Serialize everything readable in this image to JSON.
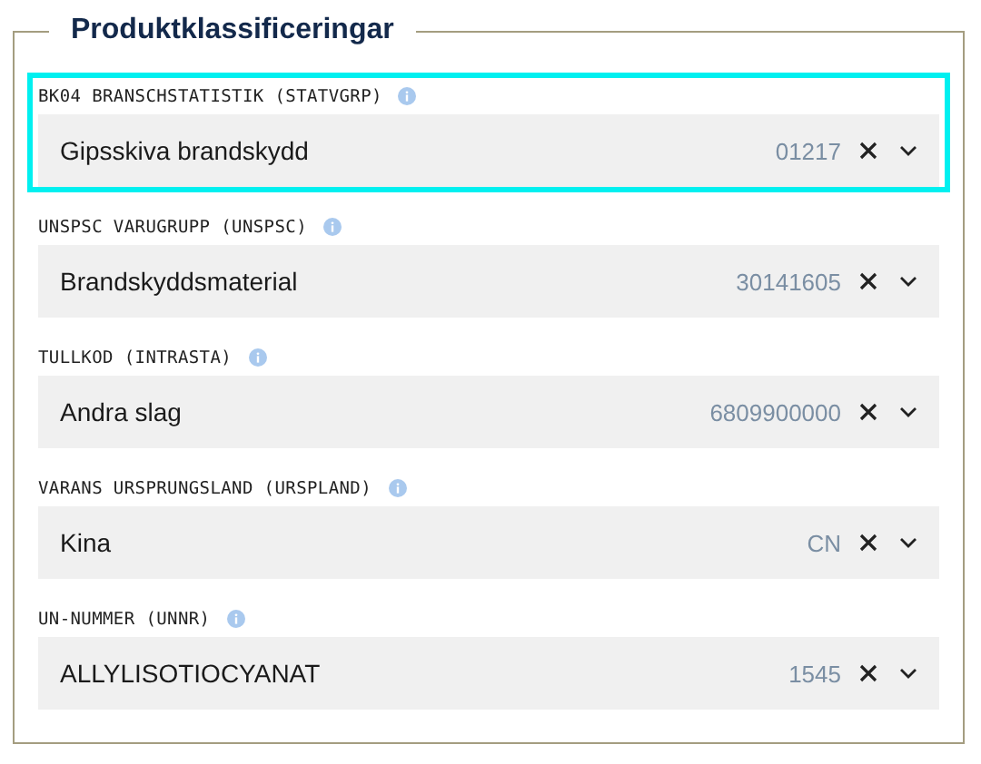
{
  "section": {
    "title": "Produktklassificeringar"
  },
  "fields": [
    {
      "label": "BK04 BRANSCHSTATISTIK (STATVGRP)",
      "value": "Gipsskiva brandskydd",
      "code": "01217",
      "focused": true
    },
    {
      "label": "UNSPSC VARUGRUPP (UNSPSC)",
      "value": "Brandskyddsmaterial",
      "code": "30141605",
      "focused": false
    },
    {
      "label": "TULLKOD (INTRASTA)",
      "value": "Andra slag",
      "code": "6809900000",
      "focused": false
    },
    {
      "label": "VARANS URSPRUNGSLAND (URSPLAND)",
      "value": "Kina",
      "code": "CN",
      "focused": false
    },
    {
      "label": "UN-NUMMER (UNNR)",
      "value": "ALLYLISOTIOCYANAT",
      "code": "1545",
      "focused": false
    }
  ]
}
